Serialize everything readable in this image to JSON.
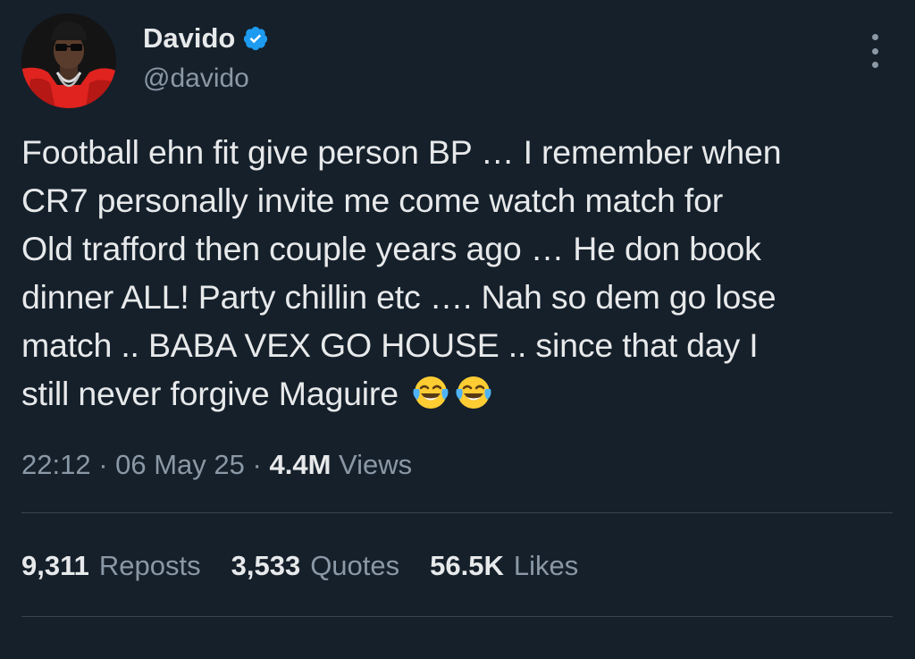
{
  "author": {
    "display_name": "Davido",
    "handle": "@davido",
    "verified_icon": "verified-badge-icon",
    "avatar_icon": "profile-avatar"
  },
  "tweet": {
    "text": "Football ehn fit give person BP … I remember when\nCR7 personally invite me come watch match for\nOld trafford then couple years ago … He don book\ndinner ALL! Party chillin etc …. Nah so dem go lose\nmatch .. BABA VEX GO HOUSE .. since that day I\nstill never forgive Maguire",
    "emoji": [
      "face-with-tears-of-joy",
      "face-with-tears-of-joy"
    ]
  },
  "meta": {
    "time": "22:12",
    "separator": " · ",
    "date": "06 May 25",
    "views_count": "4.4M",
    "views_label": "Views"
  },
  "stats": [
    {
      "count": "9,311",
      "label": "Reposts"
    },
    {
      "count": "3,533",
      "label": "Quotes"
    },
    {
      "count": "56.5K",
      "label": "Likes"
    }
  ],
  "colors": {
    "background": "#15202b",
    "text_primary": "#e7e9ea",
    "text_secondary": "#8b98a5",
    "verified_blue": "#1d9bf0",
    "divider": "#38444d"
  }
}
